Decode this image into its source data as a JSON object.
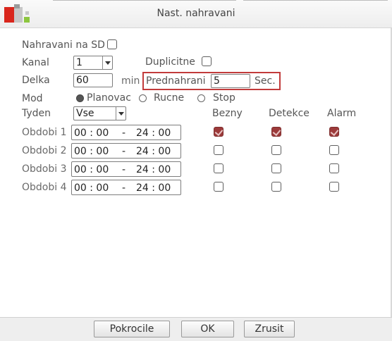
{
  "window": {
    "title": "Nast. nahravani"
  },
  "record_sd": {
    "label": "Nahravani na SD",
    "checked": false
  },
  "channel": {
    "label": "Kanal",
    "value": "1"
  },
  "duplicate": {
    "label": "Duplicitne",
    "checked": false
  },
  "length": {
    "label": "Delka",
    "value": "60",
    "unit": "min"
  },
  "prerecord": {
    "label": "Prednahrani",
    "value": "5",
    "unit": "Sec."
  },
  "mode": {
    "label": "Mod",
    "options": [
      "Planovac",
      "Rucne",
      "Stop"
    ],
    "selected": "Planovac"
  },
  "week": {
    "label": "Tyden",
    "value": "Vse"
  },
  "columns": [
    "Bezny",
    "Detekce",
    "Alarm"
  ],
  "periods": [
    {
      "label": "Obdobi 1",
      "start": "00 : 00",
      "sep": "-",
      "end": "24 : 00",
      "bezny": true,
      "detekce": true,
      "alarm": true
    },
    {
      "label": "Obdobi 2",
      "start": "00 : 00",
      "sep": "-",
      "end": "24 : 00",
      "bezny": false,
      "detekce": false,
      "alarm": false
    },
    {
      "label": "Obdobi 3",
      "start": "00 : 00",
      "sep": "-",
      "end": "24 : 00",
      "bezny": false,
      "detekce": false,
      "alarm": false
    },
    {
      "label": "Obdobi 4",
      "start": "00 : 00",
      "sep": "-",
      "end": "24 : 00",
      "bezny": false,
      "detekce": false,
      "alarm": false
    }
  ],
  "buttons": {
    "advanced": "Pokrocile",
    "ok": "OK",
    "cancel": "Zrusit"
  },
  "colors": {
    "highlight": "#c23b3b",
    "checked": "#9c3a3a",
    "logo_red": "#d9261c",
    "logo_green": "#8dc63f"
  }
}
